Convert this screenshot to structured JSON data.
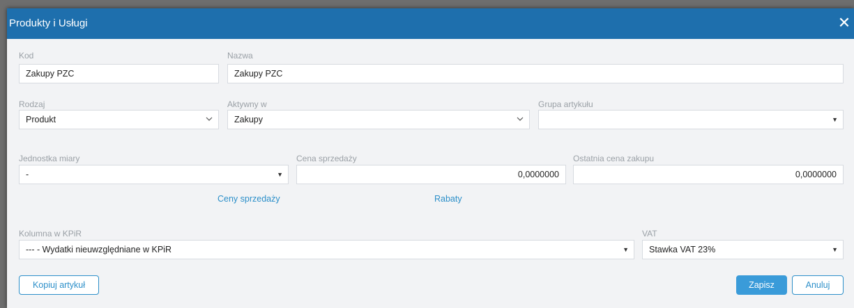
{
  "dialog": {
    "title": "Produkty i Usługi",
    "close_icon": "close-icon"
  },
  "fields": {
    "kod": {
      "label": "Kod",
      "value": "Zakupy PZC"
    },
    "nazwa": {
      "label": "Nazwa",
      "value": "Zakupy PZC"
    },
    "rodzaj": {
      "label": "Rodzaj",
      "value": "Produkt"
    },
    "aktywny_w": {
      "label": "Aktywny w",
      "value": "Zakupy"
    },
    "grupa_artykulu": {
      "label": "Grupa artykułu",
      "value": ""
    },
    "jednostka_miary": {
      "label": "Jednostka miary",
      "value": "-"
    },
    "cena_sprzedazy": {
      "label": "Cena sprzedaży",
      "value": "0,0000000"
    },
    "ostatnia_cena_zakupu": {
      "label": "Ostatnia cena zakupu",
      "value": "0,0000000"
    },
    "kolumna_kpir": {
      "label": "Kolumna w KPiR",
      "value": "--- - Wydatki nieuwzględniane w KPiR"
    },
    "vat": {
      "label": "VAT",
      "value": "Stawka VAT 23%"
    }
  },
  "links": {
    "ceny_sprzedazy": "Ceny sprzedaży",
    "rabaty": "Rabaty"
  },
  "buttons": {
    "kopiuj": "Kopiuj artykuł",
    "zapisz": "Zapisz",
    "anuluj": "Anuluj"
  },
  "glyphs": {
    "dropdown_arrow": "▼"
  },
  "colors": {
    "titlebar": "#1e6fad",
    "accent": "#2c8fc9",
    "primary_button": "#3a9bd9"
  }
}
